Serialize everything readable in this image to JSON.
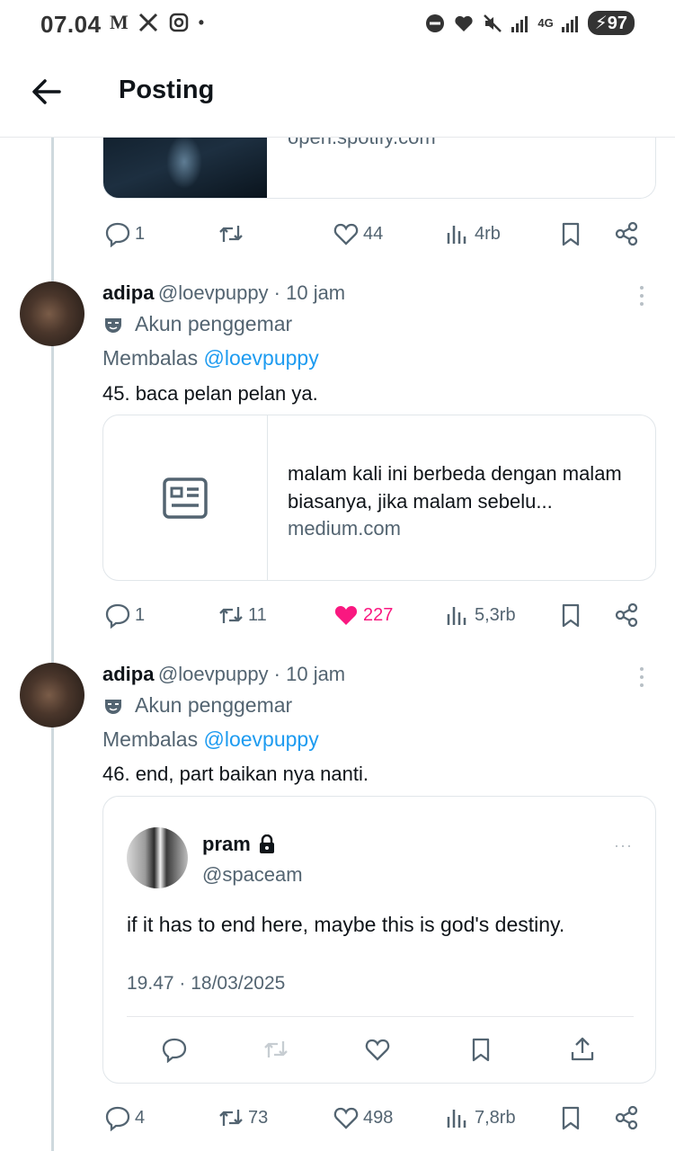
{
  "status_bar": {
    "time": "07.04",
    "notif_text": "M",
    "network": "4G",
    "battery": "97"
  },
  "header": {
    "title": "Posting"
  },
  "top_card": {
    "link_text": "open.spotify.com"
  },
  "top_actions": {
    "replies": "1",
    "retweets": "",
    "likes": "44",
    "views": "4rb"
  },
  "tweets": [
    {
      "name": "adipa",
      "meta": "@loevpuppy · 10 jam",
      "fan_label": "Akun penggemar",
      "reply_prefix": "Membalas",
      "reply_to": "@loevpuppy",
      "text": "45. baca pelan pelan ya.",
      "link_title": "malam kali ini berbeda dengan malam biasanya, jika malam sebelu...",
      "link_domain": "medium.com",
      "actions": {
        "replies": "1",
        "retweets": "11",
        "likes": "227",
        "views": "5,3rb"
      }
    },
    {
      "name": "adipa",
      "meta": "@loevpuppy · 10 jam",
      "fan_label": "Akun penggemar",
      "reply_prefix": "Membalas",
      "reply_to": "@loevpuppy",
      "text": "46. end, part baikan nya nanti.",
      "quoted": {
        "name": "pram",
        "handle": "@spaceam",
        "text": "if it has to end here, maybe this is god's destiny.",
        "timestamp": "19.47 · 18/03/2025"
      },
      "actions": {
        "replies": "4",
        "retweets": "73",
        "likes": "498",
        "views": "7,8rb"
      }
    }
  ],
  "colors": {
    "like_active": "#f91880",
    "link": "#1d9bf0",
    "muted": "#536471"
  }
}
